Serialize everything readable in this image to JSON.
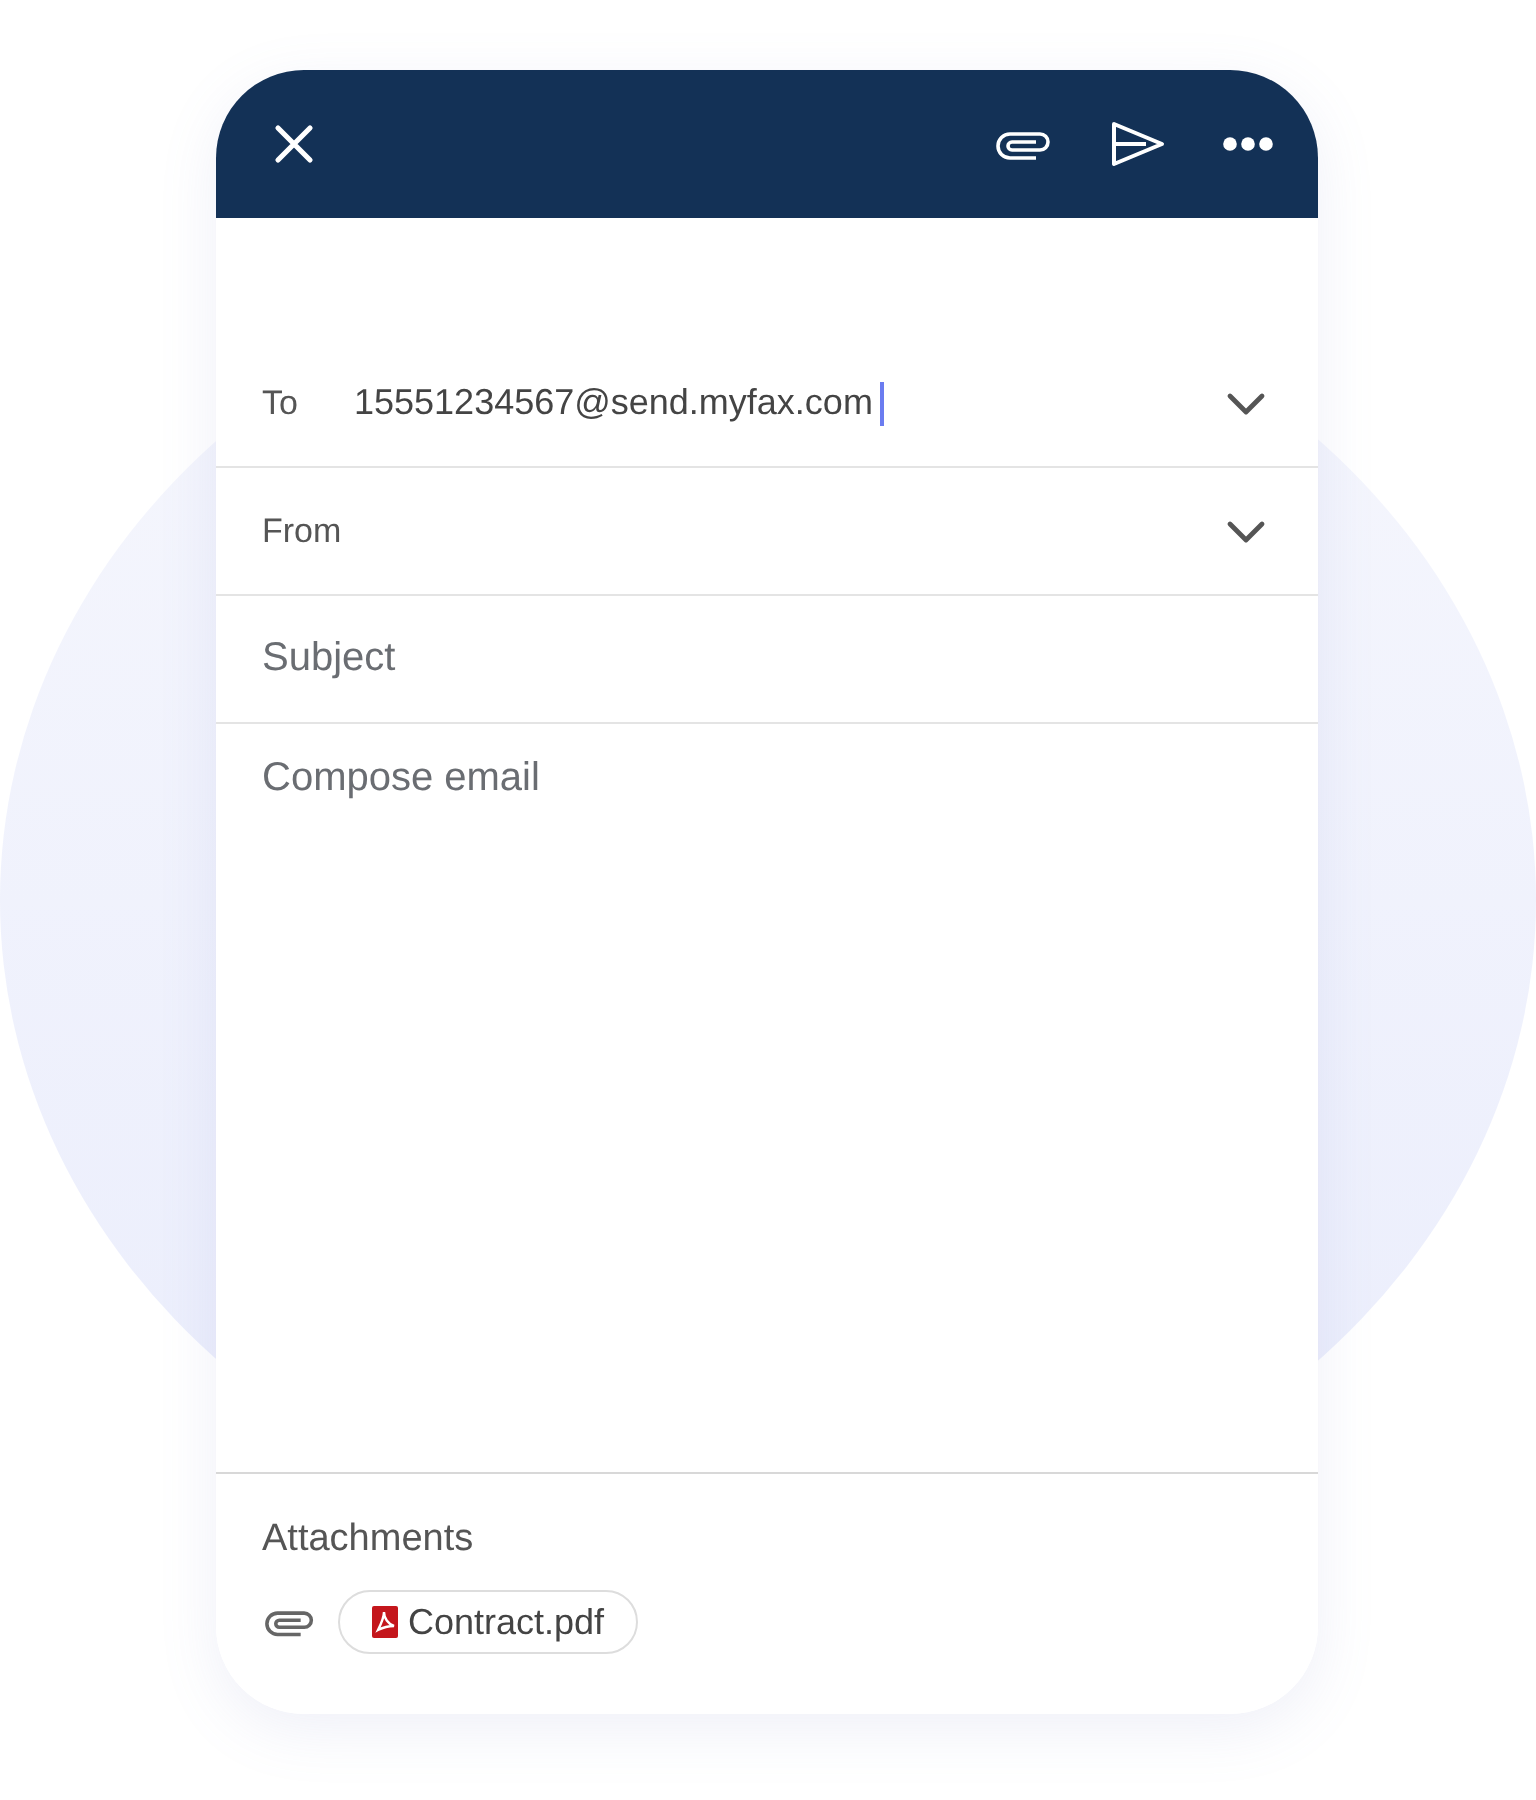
{
  "to": {
    "label": "To",
    "value": "15551234567@send.myfax.com",
    "focused": true
  },
  "from": {
    "label": "From"
  },
  "subject": {
    "placeholder": "Subject"
  },
  "body": {
    "placeholder": "Compose email"
  },
  "attachments": {
    "title": "Attachments",
    "files": [
      {
        "name": "Contract.pdf",
        "kind": "pdf"
      }
    ]
  }
}
